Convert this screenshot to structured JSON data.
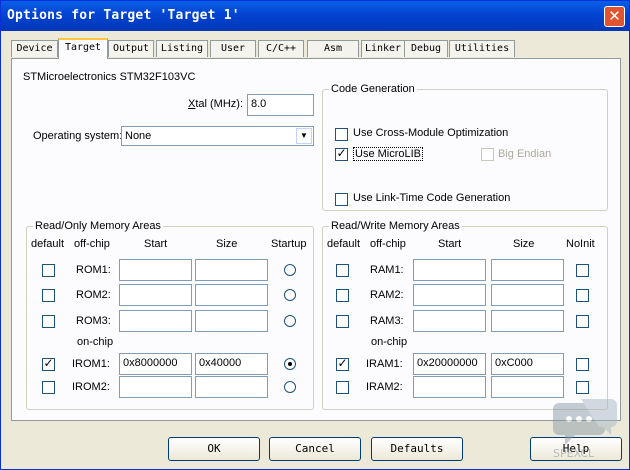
{
  "window": {
    "title": "Options for Target 'Target 1'",
    "close_symbol": "✕"
  },
  "tabs": [
    "Device",
    "Target",
    "Output",
    "Listing",
    "User",
    "C/C++",
    "Asm",
    "Linker",
    "Debug",
    "Utilities"
  ],
  "active_tab": "Target",
  "device_name": "STMicroelectronics STM32F103VC",
  "xtal": {
    "label_prefix": "X",
    "label_rest": "tal (MHz):",
    "value": "8.0"
  },
  "os": {
    "label": "Operating system:",
    "value": "None"
  },
  "code_gen": {
    "title": "Code Generation",
    "cross_module": {
      "label": "Use Cross-Module Optimization",
      "checked": false
    },
    "microlib": {
      "label": "Use MicroLIB",
      "checked": true
    },
    "big_endian": {
      "label": "Big Endian",
      "checked": false,
      "enabled": false
    },
    "ltcg": {
      "label": "Use Link-Time Code Generation",
      "checked": false
    }
  },
  "ro_mem": {
    "title": "Read/Only Memory Areas",
    "headers": {
      "default": "default",
      "offchip": "off-chip",
      "start": "Start",
      "size": "Size",
      "last": "Startup"
    },
    "onchip_label": "on-chip",
    "rows": [
      {
        "label": "ROM1:",
        "default": false,
        "start": "",
        "size": "",
        "selected": false
      },
      {
        "label": "ROM2:",
        "default": false,
        "start": "",
        "size": "",
        "selected": false
      },
      {
        "label": "ROM3:",
        "default": false,
        "start": "",
        "size": "",
        "selected": false
      },
      {
        "label": "IROM1:",
        "default": true,
        "start": "0x8000000",
        "size": "0x40000",
        "selected": true
      },
      {
        "label": "IROM2:",
        "default": false,
        "start": "",
        "size": "",
        "selected": false
      }
    ]
  },
  "rw_mem": {
    "title": "Read/Write Memory Areas",
    "headers": {
      "default": "default",
      "offchip": "off-chip",
      "start": "Start",
      "size": "Size",
      "last": "NoInit"
    },
    "onchip_label": "on-chip",
    "rows": [
      {
        "label": "RAM1:",
        "default": false,
        "start": "",
        "size": "",
        "noinit": false
      },
      {
        "label": "RAM2:",
        "default": false,
        "start": "",
        "size": "",
        "noinit": false
      },
      {
        "label": "RAM3:",
        "default": false,
        "start": "",
        "size": "",
        "noinit": false
      },
      {
        "label": "IRAM1:",
        "default": true,
        "start": "0x20000000",
        "size": "0xC000",
        "noinit": false
      },
      {
        "label": "IRAM2:",
        "default": false,
        "start": "",
        "size": "",
        "noinit": false
      }
    ]
  },
  "buttons": {
    "ok": "OK",
    "cancel": "Cancel",
    "defaults": "Defaults",
    "help": "Help"
  },
  "watermark_text": "SPEXCL"
}
